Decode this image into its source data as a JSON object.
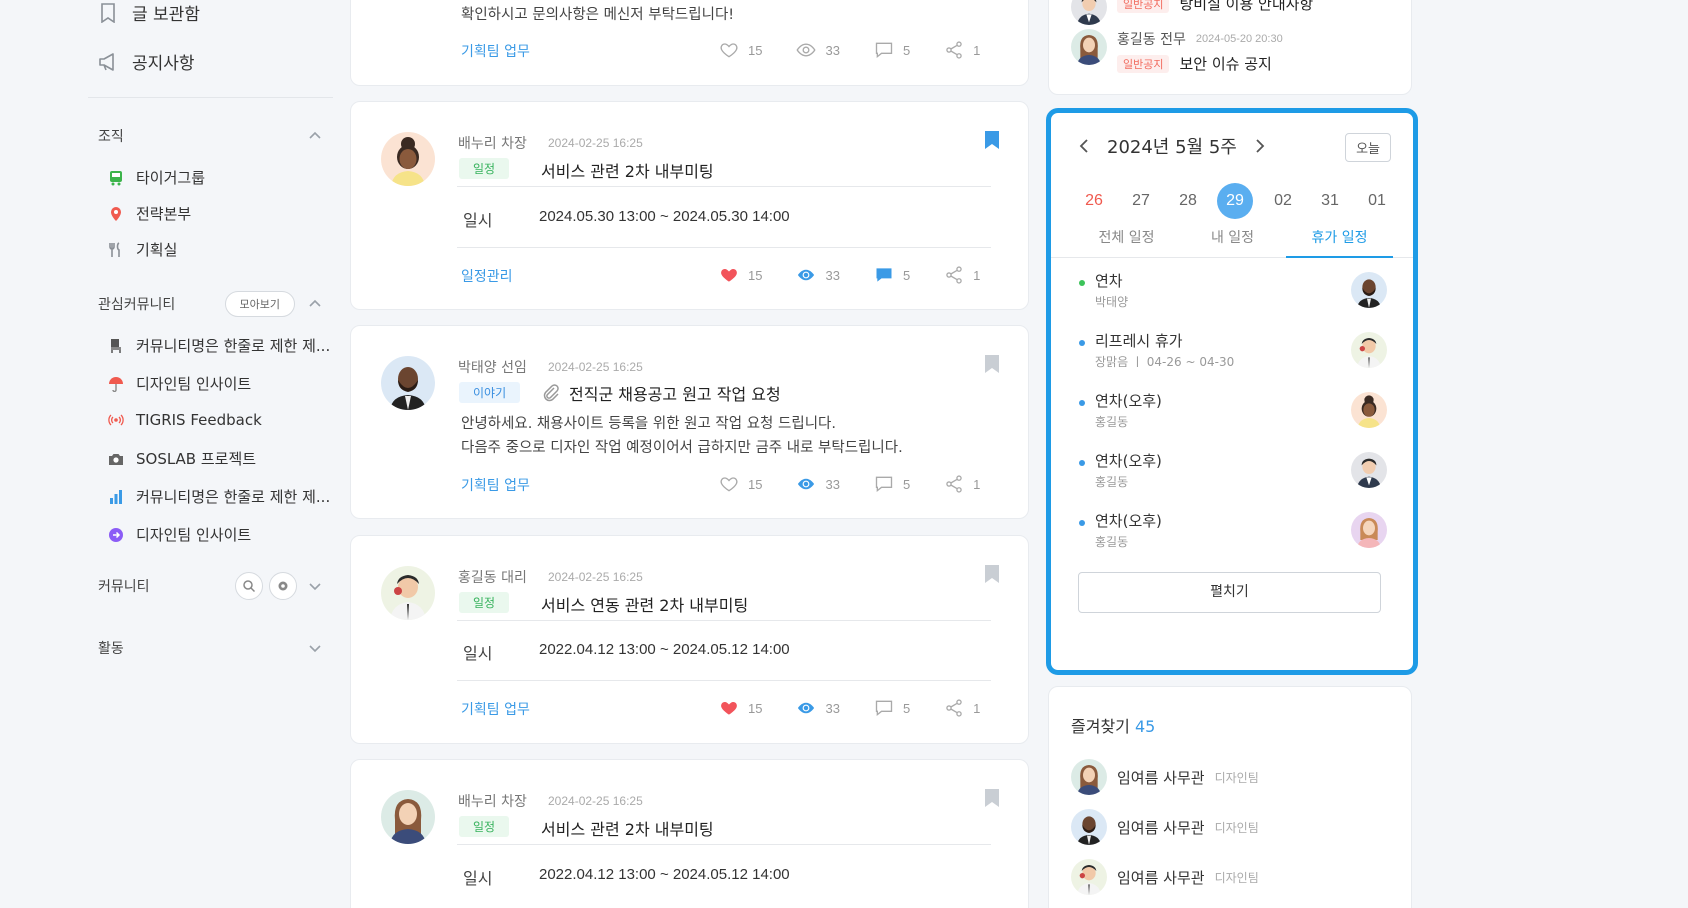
{
  "sidebar": {
    "top_items": [
      {
        "label": "글 보관함",
        "icon": "bookmark-outline-icon"
      },
      {
        "label": "공지사항",
        "icon": "megaphone-icon"
      }
    ],
    "org": {
      "title": "조직",
      "items": [
        {
          "label": "타이거그룹",
          "icon": "bus-icon",
          "color": "#3cb44b"
        },
        {
          "label": "전략본부",
          "icon": "map-pin-icon",
          "color": "#f05a4f"
        },
        {
          "label": "기획실",
          "icon": "utensils-icon",
          "color": "#8a8f96"
        }
      ]
    },
    "interest": {
      "title": "관심커뮤니티",
      "more_label": "모아보기",
      "items": [
        {
          "label": "커뮤니티명은 한줄로 제한 제...",
          "icon": "chair-icon"
        },
        {
          "label": "디자인팀 인사이트",
          "icon": "umbrella-icon"
        },
        {
          "label": "TIGRIS Feedback",
          "icon": "broadcast-icon"
        },
        {
          "label": "SOSLAB 프로젝트",
          "icon": "camera-icon"
        },
        {
          "label": "커뮤니티명은 한줄로 제한 제...",
          "icon": "bar-chart-icon"
        },
        {
          "label": "디자인팀 인사이트",
          "icon": "arrow-circle-icon"
        }
      ]
    },
    "community_title": "커뮤니티",
    "activity_title": "활동"
  },
  "feed": {
    "partial_top": {
      "body": "확인하시고 문의사항은 메신저 부탁드립니다!",
      "category": "기획팀 업무",
      "likes": "15",
      "views": "33",
      "comments": "5",
      "shares": "1"
    },
    "posts": [
      {
        "author": "배누리 차장",
        "date": "2024-02-25 16:25",
        "tag": "일정",
        "title": "서비스 관련 2차 내부미팅",
        "schedule_label": "일시",
        "schedule": "2024.05.30 13:00 ~ 2024.05.30 14:00",
        "category": "일정관리",
        "likes": "15",
        "views": "33",
        "comments": "5",
        "shares": "1"
      },
      {
        "author": "박태양 선임",
        "date": "2024-02-25 16:25",
        "tag": "이야기",
        "title": "전직군 채용공고 원고 작업 요청",
        "body_lines": [
          "안녕하세요. 채용사이트 등록을 위한 원고 작업 요청 드립니다.",
          "다음주 중으로 디자인 작업 예정이어서 급하지만 금주 내로 부탁드립니다."
        ],
        "category": "기획팀 업무",
        "likes": "15",
        "views": "33",
        "comments": "5",
        "shares": "1"
      },
      {
        "author": "홍길동 대리",
        "date": "2024-02-25 16:25",
        "tag": "일정",
        "title": "서비스 연동 관련 2차 내부미팅",
        "schedule_label": "일시",
        "schedule": "2022.04.12 13:00 ~ 2024.05.12 14:00",
        "category": "기획팀 업무",
        "likes": "15",
        "views": "33",
        "comments": "5",
        "shares": "1"
      },
      {
        "author": "배누리 차장",
        "date": "2024-02-25 16:25",
        "tag": "일정",
        "title": "서비스 관련 2차 내부미팅",
        "schedule_label": "일시",
        "schedule": "2022.04.12 13:00 ~ 2024.05.12 14:00"
      }
    ]
  },
  "notices": [
    {
      "tag": "일반공지",
      "title": "탕비실 이용 안내사항"
    },
    {
      "author": "홍길동 전무",
      "date": "2024-05-20 20:30",
      "tag": "일반공지",
      "title": "보안 이슈 공지"
    }
  ],
  "calendar": {
    "title": "2024년 5월 5주",
    "today_label": "오늘",
    "days": [
      "26",
      "27",
      "28",
      "29",
      "02",
      "31",
      "01"
    ],
    "selected_day": "29",
    "tabs": [
      "전체 일정",
      "내 일정",
      "휴가 일정"
    ],
    "active_tab": "휴가 일정",
    "leaves": [
      {
        "type": "연차",
        "person": "박태양",
        "dot_color": "#3cc35a"
      },
      {
        "type": "리프레시 휴가",
        "person": "장맑음 ㅣ 04-26 ~ 04-30",
        "dot_color": "#3a9ae6"
      },
      {
        "type": "연차(오후)",
        "person": "홍길동",
        "dot_color": "#3a9ae6"
      },
      {
        "type": "연차(오후)",
        "person": "홍길동",
        "dot_color": "#3a9ae6"
      },
      {
        "type": "연차(오후)",
        "person": "홍길동",
        "dot_color": "#3a9ae6"
      }
    ],
    "expand_label": "펼치기"
  },
  "favorites": {
    "title": "즐겨찾기",
    "count": "45",
    "items": [
      {
        "name": "임여름 사무관",
        "dept": "디자인팀"
      },
      {
        "name": "임여름 사무관",
        "dept": "디자인팀"
      },
      {
        "name": "임여름 사무관",
        "dept": "디자인팀"
      }
    ]
  },
  "colors": {
    "accent": "#1e9be6",
    "like": "#f2545b",
    "green_tag": "#36b25c"
  }
}
